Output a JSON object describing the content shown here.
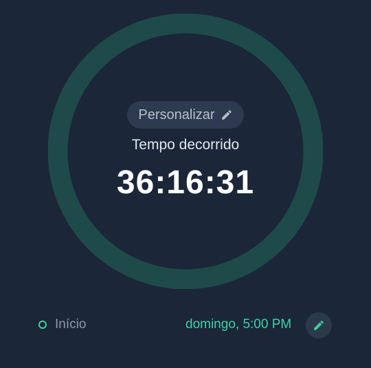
{
  "colors": {
    "background": "#1b2638",
    "ring": "#1f4a4a",
    "accent": "#3fd1a5",
    "chip_bg": "#2d3a50",
    "edit_button_bg": "#2b3a4b"
  },
  "timer": {
    "customize_label": "Personalizar",
    "customize_icon": "pencil-icon",
    "elapsed_label": "Tempo decorrido",
    "elapsed_value": "36:16:31"
  },
  "start": {
    "label": "Início",
    "time": "domingo, 5:00 PM",
    "edit_icon": "pencil-icon"
  }
}
